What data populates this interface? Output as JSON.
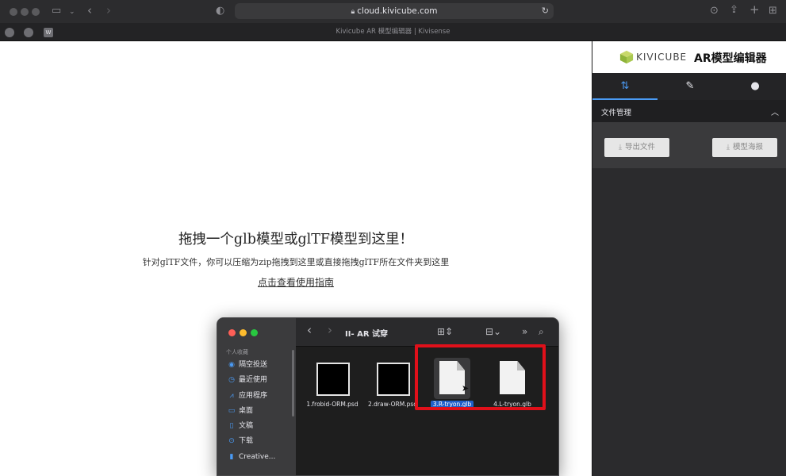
{
  "browser": {
    "url": "cloud.kivicube.com",
    "tab_title": "Kivicube AR 模型编辑器 | Kivisense",
    "pinned_tabs": [
      "",
      "",
      "W"
    ]
  },
  "page": {
    "drop_title": "拖拽一个glb模型或glTF模型到这里！",
    "drop_subtitle": "针对glTF文件，你可以压缩为zip拖拽到这里或直接拖拽glTF所在文件夹到这里",
    "guide_link": "点击查看使用指南"
  },
  "finder": {
    "title": "II- AR 试穿",
    "sidebar_header": "个人收藏",
    "sidebar_items": [
      {
        "label": "隔空投送",
        "icon": "airdrop-icon"
      },
      {
        "label": "最近使用",
        "icon": "clock-icon"
      },
      {
        "label": "应用程序",
        "icon": "applications-icon"
      },
      {
        "label": "桌面",
        "icon": "desktop-icon"
      },
      {
        "label": "文稿",
        "icon": "document-icon"
      },
      {
        "label": "下载",
        "icon": "download-icon"
      },
      {
        "label": "Creative...",
        "icon": "folder-icon"
      }
    ],
    "files": [
      {
        "name": "1.frobid-ORM.psd",
        "type": "psd",
        "selected": false
      },
      {
        "name": "2.draw-ORM.psd",
        "type": "psd",
        "selected": false
      },
      {
        "name": "3.R-tryon.glb",
        "type": "glb",
        "selected": true
      },
      {
        "name": "4.L-tryon.glb",
        "type": "glb",
        "selected": false
      }
    ],
    "highlight_color": "#e0101a"
  },
  "panel": {
    "logo_text": "KIVICUBE",
    "title": "AR模型编辑器",
    "tabs": [
      {
        "icon": "sort-arrows-icon",
        "active": true
      },
      {
        "icon": "pencil-icon",
        "active": false
      },
      {
        "icon": "palette-icon",
        "active": false
      }
    ],
    "section_title": "文件管理",
    "export_button": "导出文件",
    "poster_button": "模型海报",
    "accent_color": "#4a9bf5"
  }
}
